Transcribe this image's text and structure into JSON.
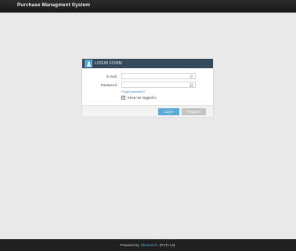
{
  "header": {
    "brand": "Purchase Managment System"
  },
  "login": {
    "title": "LOGIN FORM",
    "email_label": "E-mail",
    "email_value": "",
    "password_label": "Password",
    "password_value": "",
    "forgot_text": "Forgot password?",
    "keep_label": "Keep me logged in",
    "keep_checked": true,
    "login_button": "Log in",
    "register_button": "Register"
  },
  "footer": {
    "prefix": "Powered by",
    "company": "Shanotech",
    "suffix": "(PVT) Ltd."
  },
  "icons": {
    "header": "user-icon",
    "email": "user-icon",
    "password": "lock-icon",
    "keep": "check-icon"
  },
  "colors": {
    "topbar": "#1f1f1f",
    "panel_head": "#35495c",
    "accent": "#5ba9d6",
    "register": "#c3c3c3",
    "footer": "#202020"
  }
}
